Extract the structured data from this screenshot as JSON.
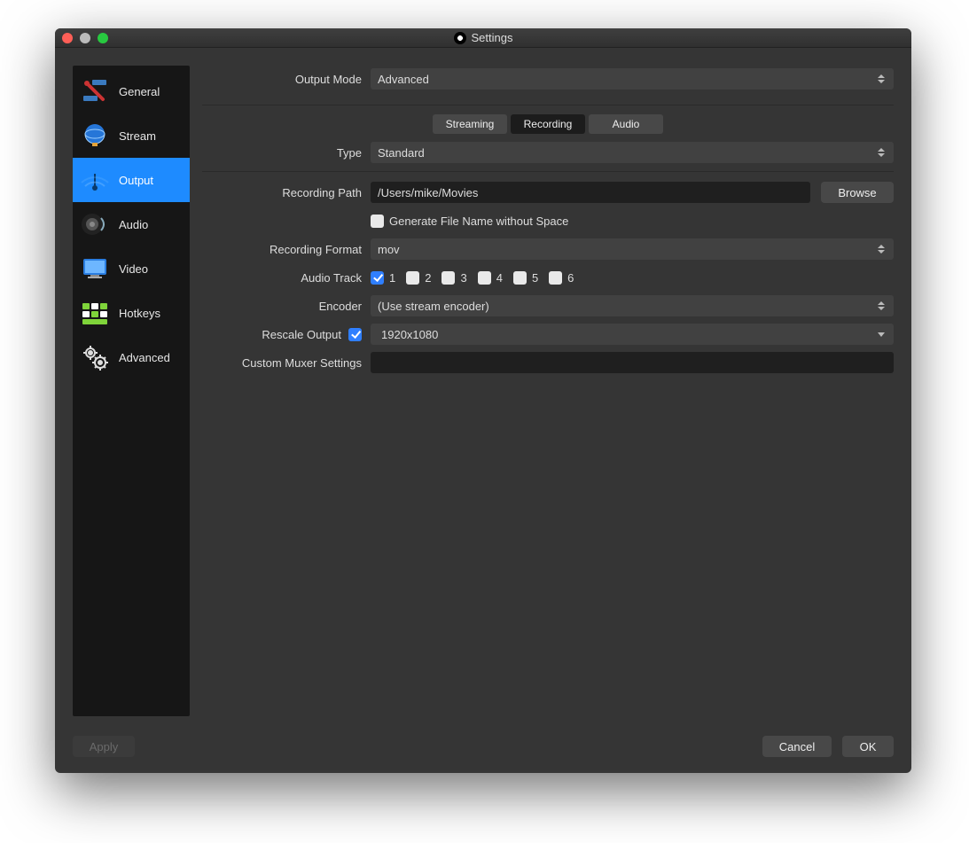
{
  "window": {
    "title": "Settings"
  },
  "sidebar": {
    "items": [
      {
        "label": "General"
      },
      {
        "label": "Stream"
      },
      {
        "label": "Output"
      },
      {
        "label": "Audio"
      },
      {
        "label": "Video"
      },
      {
        "label": "Hotkeys"
      },
      {
        "label": "Advanced"
      }
    ],
    "active_index": 2
  },
  "output_mode": {
    "label": "Output Mode",
    "value": "Advanced"
  },
  "tabs": {
    "items": [
      "Streaming",
      "Recording",
      "Audio"
    ],
    "active_index": 1
  },
  "type": {
    "label": "Type",
    "value": "Standard"
  },
  "recording_path": {
    "label": "Recording Path",
    "value": "/Users/mike/Movies",
    "browse": "Browse"
  },
  "gen_filename": {
    "label": "Generate File Name without Space",
    "checked": false
  },
  "recording_format": {
    "label": "Recording Format",
    "value": "mov"
  },
  "audio_track": {
    "label": "Audio Track",
    "tracks": [
      {
        "n": "1",
        "checked": true
      },
      {
        "n": "2",
        "checked": false
      },
      {
        "n": "3",
        "checked": false
      },
      {
        "n": "4",
        "checked": false
      },
      {
        "n": "5",
        "checked": false
      },
      {
        "n": "6",
        "checked": false
      }
    ]
  },
  "encoder": {
    "label": "Encoder",
    "value": "(Use stream encoder)"
  },
  "rescale": {
    "label": "Rescale Output",
    "checked": true,
    "value": "1920x1080"
  },
  "muxer": {
    "label": "Custom Muxer Settings",
    "value": ""
  },
  "footer": {
    "apply": "Apply",
    "cancel": "Cancel",
    "ok": "OK"
  }
}
